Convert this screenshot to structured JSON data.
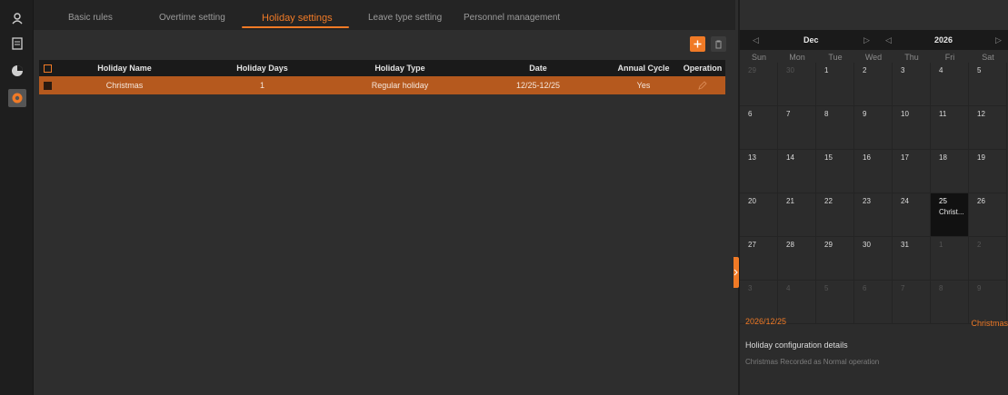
{
  "tabs": [
    {
      "label": "Basic rules",
      "active": false
    },
    {
      "label": "Overtime setting",
      "active": false
    },
    {
      "label": "Holiday settings",
      "active": true
    },
    {
      "label": "Leave type setting",
      "active": false
    },
    {
      "label": "Personnel management",
      "active": false
    }
  ],
  "toolbar": {
    "add_icon": "plus-icon",
    "delete_icon": "trash-icon"
  },
  "table": {
    "columns": [
      "Holiday Name",
      "Holiday Days",
      "Holiday Type",
      "Date",
      "Annual Cycle",
      "Operation"
    ],
    "rows": [
      {
        "name": "Christmas",
        "days": "1",
        "type": "Regular holiday",
        "date": "12/25-12/25",
        "cycle": "Yes",
        "operation_icon": "edit-pencil-icon"
      }
    ]
  },
  "calendar": {
    "month": "Dec",
    "year": "2026",
    "weekdays": [
      "Sun",
      "Mon",
      "Tue",
      "Wed",
      "Thu",
      "Fri",
      "Sat"
    ],
    "weeks": [
      [
        "29",
        "30",
        "1",
        "2",
        "3",
        "4",
        "5"
      ],
      [
        "6",
        "7",
        "8",
        "9",
        "10",
        "11",
        "12"
      ],
      [
        "13",
        "14",
        "15",
        "16",
        "17",
        "18",
        "19"
      ],
      [
        "20",
        "21",
        "22",
        "23",
        "24",
        "25",
        "26"
      ],
      [
        "27",
        "28",
        "29",
        "30",
        "31",
        "1",
        "2"
      ],
      [
        "3",
        "4",
        "5",
        "6",
        "7",
        "8",
        "9"
      ]
    ],
    "selected_event": "Christ..."
  },
  "detail": {
    "date": "2026/12/25",
    "holiday": "Christmas",
    "title": "Holiday configuration details",
    "description": "Christmas Recorded as Normal operation"
  },
  "colors": {
    "accent": "#f07a26",
    "row_selected": "#b5591e",
    "background": "#2e2e2e"
  }
}
